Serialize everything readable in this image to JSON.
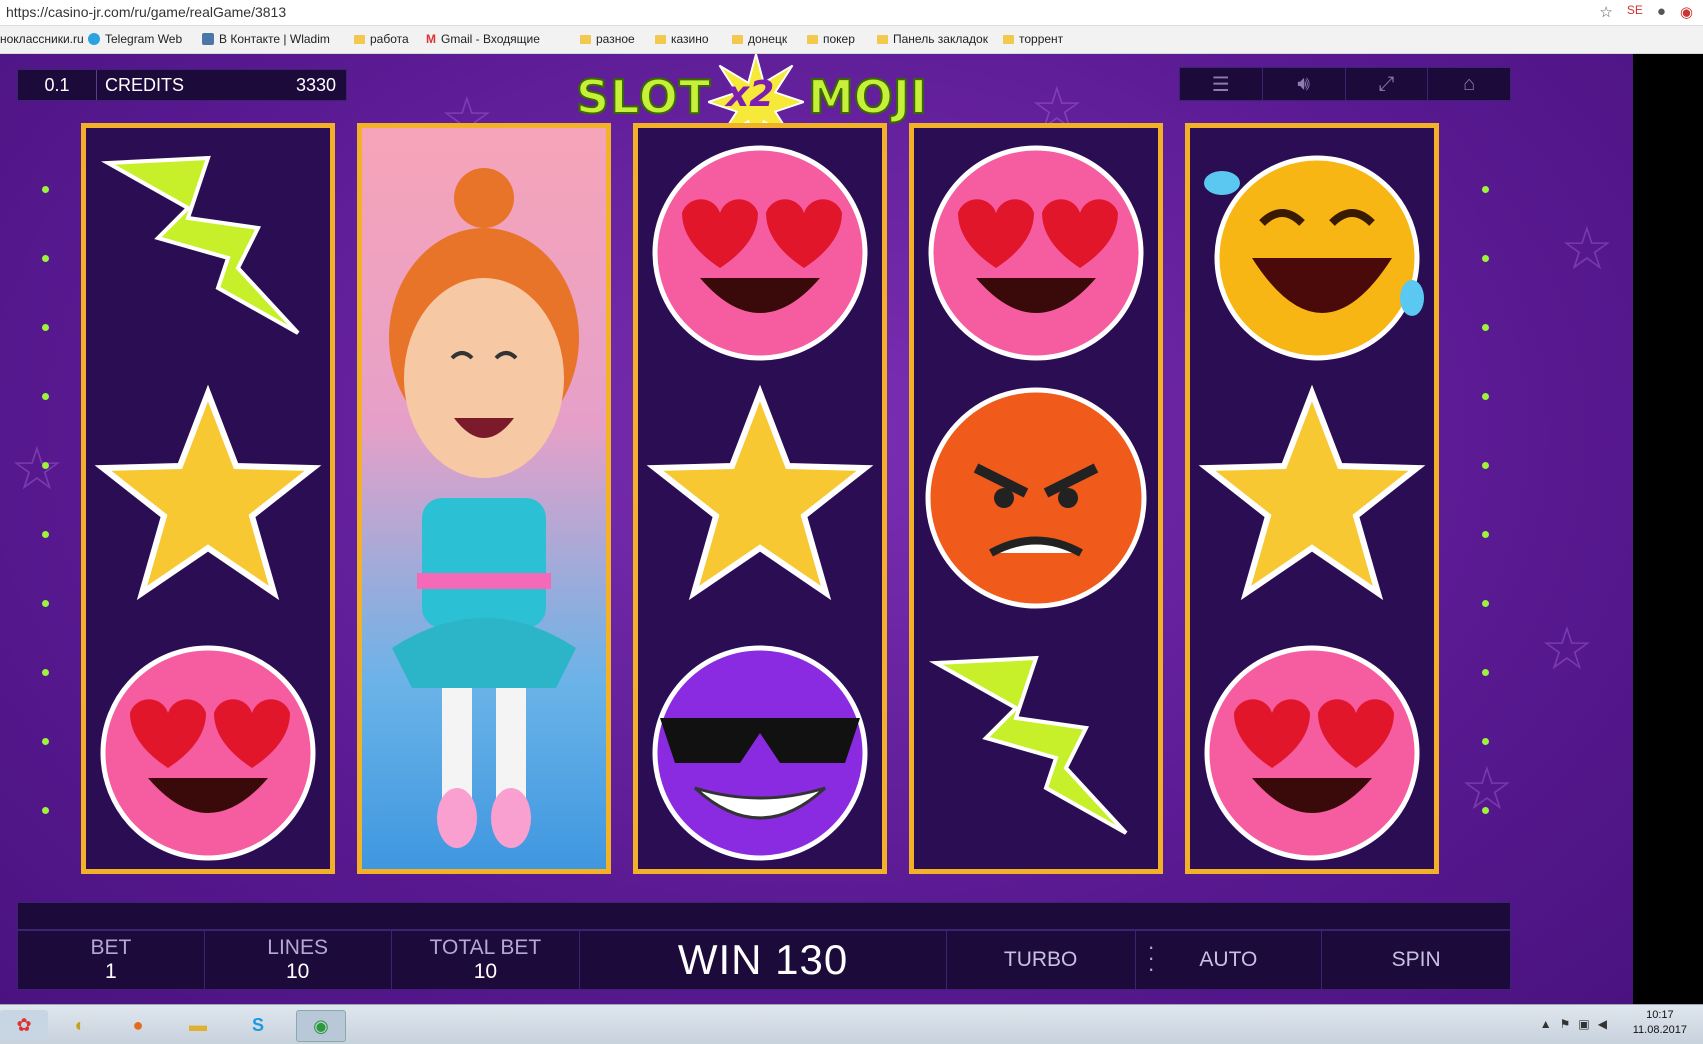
{
  "browser": {
    "url": "https://casino-jr.com/ru/game/realGame/3813",
    "bookmarks": [
      "ноклассники.ru",
      "Telegram Web",
      "В Контакте | Wladim",
      "работа",
      "Gmail - Входящие",
      "разное",
      "казино",
      "донецк",
      "покер",
      "Панель закладок",
      "торрент"
    ]
  },
  "game": {
    "bet_value": "0.1",
    "credits_label": "CREDITS",
    "credits_value": "3330",
    "logo": {
      "left": "SLOT",
      "mid": "x2",
      "right": "MOJI"
    },
    "top_buttons": [
      "menu-icon",
      "sound-icon",
      "fullscreen-icon",
      "home-icon"
    ],
    "reels": [
      [
        "bolt",
        "star",
        "heart-eyes"
      ],
      [
        "ballerina"
      ],
      [
        "heart-eyes",
        "star",
        "sunglasses"
      ],
      [
        "heart-eyes",
        "angry",
        "bolt"
      ],
      [
        "laughing",
        "star",
        "heart-eyes"
      ]
    ],
    "bottom": {
      "bet_label": "BET",
      "bet_value": "1",
      "lines_label": "LINES",
      "lines_value": "10",
      "total_label": "TOTAL BET",
      "total_value": "10",
      "win_text": "WIN 130",
      "turbo": "TURBO",
      "auto": "AUTO",
      "spin": "SPIN"
    },
    "colors": {
      "reel_border": "#f3b128",
      "background": "#5a1a92",
      "bar": "#1c0a3a"
    }
  },
  "taskbar": {
    "time": "10:17",
    "date": "11.08.2017"
  }
}
